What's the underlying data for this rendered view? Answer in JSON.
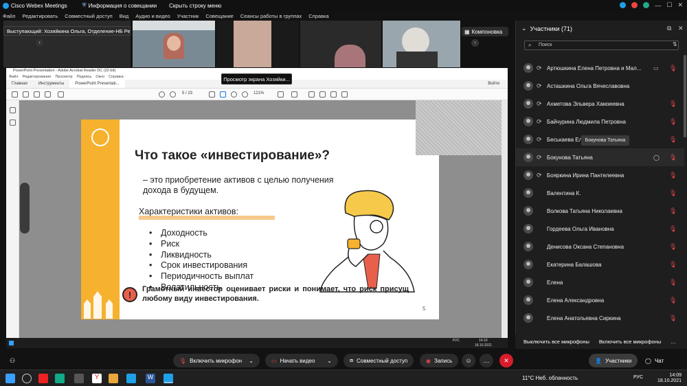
{
  "titlebar": {
    "app_title": "Cisco Webex Meetings",
    "meeting_info": "Информация о совещании",
    "hide_menu": "Скрыть строку меню"
  },
  "menu": [
    "Файл",
    "Редактировать",
    "Совместный доступ",
    "Вид",
    "Аудио и видео",
    "Участник",
    "Совещание",
    "Сеансы работы в группах",
    "Справка"
  ],
  "video_strip": {
    "speaker_label": "Выступающий: Хозяйкина Ольга, Отделение-НБ Ре...",
    "layout_button": "Компоновка"
  },
  "share_tooltip": "Просмотр экрана Хозяйки...",
  "adobe": {
    "window_title": "PowerPoint Presentation - Adobe Acrobat Reader DC (32-bit)",
    "menu": [
      "Файл",
      "Редактирование",
      "Просмотр",
      "Подпись",
      "Окно",
      "Справка"
    ],
    "tabs": [
      "Главная",
      "Инструменты",
      "PowerPoint Presentati..."
    ],
    "page_indicator": "5 / 23",
    "zoom": "121%",
    "login": "Войти",
    "clock_time": "14:10",
    "clock_date": "18.10.2021",
    "lang": "РУС"
  },
  "slide": {
    "title": "Что такое «инвестирование»?",
    "definition": "– это приобретение активов с целью получения дохода в будущем.",
    "chars_heading": "Характеристики активов:",
    "items": [
      "Доходность",
      "Риск",
      "Ликвидность",
      "Срок инвестирования",
      "Периодичность выплат",
      "Волатильность"
    ],
    "warning": "Грамотный инвестор оценивает риски и понимает, что риск присущ любому виду инвестирования.",
    "page_number": "5"
  },
  "participants_panel": {
    "header": "Участники (71)",
    "search_placeholder": "Поиск",
    "rows": [
      {
        "name": "Артюшкина Елена Петровна и Мал...",
        "cam": true
      },
      {
        "name": "Асташкина Ольга Вячеславовна"
      },
      {
        "name": "Ахметова Эльвера Хамзеевна"
      },
      {
        "name": "Байчурина Людмила Петровна"
      },
      {
        "name": "Беськаева Еле..."
      },
      {
        "name": "Бокунова Татьяна",
        "chat": true
      },
      {
        "name": "Бояркина Ирина Пантелеевна"
      },
      {
        "name": "Валентина К."
      },
      {
        "name": "Волкова Татьяна Николаевна"
      },
      {
        "name": "Гордеева Ольга Ивановна"
      },
      {
        "name": "Денисова Оксана Степановна"
      },
      {
        "name": "Екатерина Балашова"
      },
      {
        "name": "Елена"
      },
      {
        "name": "Елена Александровна"
      },
      {
        "name": "Елена Анатольевна Сиркина"
      }
    ],
    "tooltip": "Бокунова Татьяна",
    "mute_all": "Выключить все микрофоны",
    "unmute_all": "Включить все микрофоны"
  },
  "controls": {
    "unmute": "Включить микрофон",
    "start_video": "Начать видео",
    "share": "Совместный доступ",
    "record": "Запись",
    "participants": "Участники",
    "chat": "Чат"
  },
  "taskbar": {
    "weather": "11°C  Неб. облачность",
    "lang": "РУС",
    "time": "14:09",
    "date": "18.10.2021"
  },
  "colors": {
    "accent_orange": "#f6b12e",
    "mute_red": "#e5484d",
    "end_red": "#d91c2b"
  }
}
